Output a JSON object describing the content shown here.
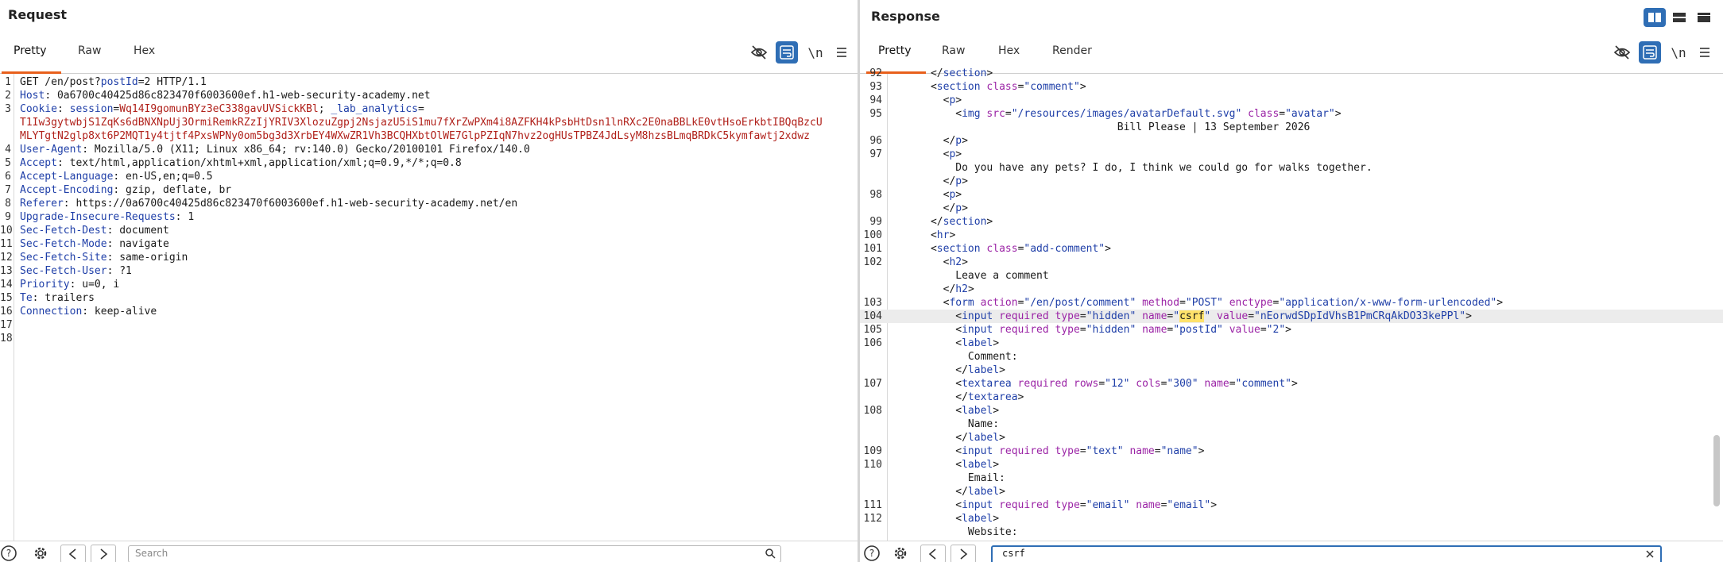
{
  "request": {
    "title": "Request",
    "tabs": [
      "Pretty",
      "Raw",
      "Hex"
    ],
    "active_tab": "Pretty",
    "newline_label": "\\n",
    "search_placeholder": "Search",
    "lines": [
      {
        "n": "1",
        "parts": [
          [
            "",
            "GET /en/post?"
          ],
          [
            "k",
            "postId"
          ],
          [
            "",
            "=2 HTTP/1.1"
          ]
        ]
      },
      {
        "n": "2",
        "parts": [
          [
            "k",
            "Host"
          ],
          [
            "",
            ": 0a6700c40425d86c823470f6003600ef.h1-web-security-academy.net"
          ]
        ]
      },
      {
        "n": "3",
        "parts": [
          [
            "k",
            "Cookie"
          ],
          [
            "",
            ": "
          ],
          [
            "k",
            "session"
          ],
          [
            "",
            "="
          ],
          [
            "v",
            "Wq14I9gomunBYz3eC338gavUVSickKBl"
          ],
          [
            "",
            "; "
          ],
          [
            "k",
            "_lab_analytics"
          ],
          [
            "",
            "="
          ]
        ]
      },
      {
        "n": "",
        "parts": [
          [
            "v",
            "T1Iw3gytwbjS1ZqKs6dBNXNpUj3OrmiRemkRZzIjYRIV3XlozuZgpj2NsjazU5iS1mu7fXrZwPXm4i8AZFKH4kPsbHtDsn1lnRXc2E0naBBLkE0vtHsoErkbtIBQqBzcU"
          ]
        ]
      },
      {
        "n": "",
        "parts": [
          [
            "v",
            "MLYTgtN2glp8xt6P2MQT1y4tjtf4PxsWPNy0om5bg3d3XrbEY4WXwZR1Vh3BCQHXbtOlWE7GlpPZIqN7hvz2ogHUsTPBZ4JdLsyM8hzsBLmqBRDkC5kymfawtj2xdwz"
          ]
        ]
      },
      {
        "n": "4",
        "parts": [
          [
            "k",
            "User-Agent"
          ],
          [
            "",
            ": Mozilla/5.0 (X11; Linux x86_64; rv:140.0) Gecko/20100101 Firefox/140.0"
          ]
        ]
      },
      {
        "n": "5",
        "parts": [
          [
            "k",
            "Accept"
          ],
          [
            "",
            ": text/html,application/xhtml+xml,application/xml;q=0.9,*/*;q=0.8"
          ]
        ]
      },
      {
        "n": "6",
        "parts": [
          [
            "k",
            "Accept-Language"
          ],
          [
            "",
            ": en-US,en;q=0.5"
          ]
        ]
      },
      {
        "n": "7",
        "parts": [
          [
            "k",
            "Accept-Encoding"
          ],
          [
            "",
            ": gzip, deflate, br"
          ]
        ]
      },
      {
        "n": "8",
        "parts": [
          [
            "k",
            "Referer"
          ],
          [
            "",
            ": https://0a6700c40425d86c823470f6003600ef.h1-web-security-academy.net/en"
          ]
        ]
      },
      {
        "n": "9",
        "parts": [
          [
            "k",
            "Upgrade-Insecure-Requests"
          ],
          [
            "",
            ": 1"
          ]
        ]
      },
      {
        "n": "10",
        "parts": [
          [
            "k",
            "Sec-Fetch-Dest"
          ],
          [
            "",
            ": document"
          ]
        ]
      },
      {
        "n": "11",
        "parts": [
          [
            "k",
            "Sec-Fetch-Mode"
          ],
          [
            "",
            ": navigate"
          ]
        ]
      },
      {
        "n": "12",
        "parts": [
          [
            "k",
            "Sec-Fetch-Site"
          ],
          [
            "",
            ": same-origin"
          ]
        ]
      },
      {
        "n": "13",
        "parts": [
          [
            "k",
            "Sec-Fetch-User"
          ],
          [
            "",
            ": ?1"
          ]
        ]
      },
      {
        "n": "14",
        "parts": [
          [
            "k",
            "Priority"
          ],
          [
            "",
            ": u=0, i"
          ]
        ]
      },
      {
        "n": "15",
        "parts": [
          [
            "k",
            "Te"
          ],
          [
            "",
            ": trailers"
          ]
        ]
      },
      {
        "n": "16",
        "parts": [
          [
            "k",
            "Connection"
          ],
          [
            "",
            ": keep-alive"
          ]
        ]
      },
      {
        "n": "17",
        "parts": []
      },
      {
        "n": "18",
        "parts": []
      }
    ]
  },
  "response": {
    "title": "Response",
    "tabs": [
      "Pretty",
      "Raw",
      "Hex",
      "Render"
    ],
    "active_tab": "Pretty",
    "newline_label": "\\n",
    "search_value": "csrf",
    "lines": [
      {
        "n": "92",
        "parts": [
          [
            "",
            "      </"
          ],
          [
            "t",
            "section"
          ],
          [
            "",
            ">"
          ]
        ]
      },
      {
        "n": "93",
        "parts": [
          [
            "",
            "      <"
          ],
          [
            "t",
            "section"
          ],
          [
            "",
            " "
          ],
          [
            "a",
            "class"
          ],
          [
            "",
            "="
          ],
          [
            "s",
            "\"comment\""
          ],
          [
            "",
            ">"
          ]
        ]
      },
      {
        "n": "94",
        "parts": [
          [
            "",
            "        <"
          ],
          [
            "t",
            "p"
          ],
          [
            "",
            ">"
          ]
        ]
      },
      {
        "n": "95",
        "parts": [
          [
            "",
            "          <"
          ],
          [
            "t",
            "img"
          ],
          [
            "",
            " "
          ],
          [
            "a",
            "src"
          ],
          [
            "",
            "="
          ],
          [
            "s",
            "\"/resources/images/avatarDefault.svg\""
          ],
          [
            "",
            " "
          ],
          [
            "a",
            "class"
          ],
          [
            "",
            "="
          ],
          [
            "s",
            "\"avatar\""
          ],
          [
            "",
            ">"
          ]
        ]
      },
      {
        "n": "",
        "parts": [
          [
            "",
            "                                    Bill Please | 13 September 2026"
          ]
        ]
      },
      {
        "n": "96",
        "parts": [
          [
            "",
            "        </"
          ],
          [
            "t",
            "p"
          ],
          [
            "",
            ">"
          ]
        ]
      },
      {
        "n": "97",
        "parts": [
          [
            "",
            "        <"
          ],
          [
            "t",
            "p"
          ],
          [
            "",
            ">"
          ]
        ]
      },
      {
        "n": "",
        "parts": [
          [
            "",
            "          Do you have any pets? I do, I think we could go for walks together."
          ]
        ]
      },
      {
        "n": "",
        "parts": [
          [
            "",
            "        </"
          ],
          [
            "t",
            "p"
          ],
          [
            "",
            ">"
          ]
        ]
      },
      {
        "n": "98",
        "parts": [
          [
            "",
            "        <"
          ],
          [
            "t",
            "p"
          ],
          [
            "",
            ">"
          ]
        ]
      },
      {
        "n": "",
        "parts": [
          [
            "",
            "        </"
          ],
          [
            "t",
            "p"
          ],
          [
            "",
            ">"
          ]
        ]
      },
      {
        "n": "99",
        "parts": [
          [
            "",
            "      </"
          ],
          [
            "t",
            "section"
          ],
          [
            "",
            ">"
          ]
        ]
      },
      {
        "n": "100",
        "parts": [
          [
            "",
            "      <"
          ],
          [
            "t",
            "hr"
          ],
          [
            "",
            ">"
          ]
        ]
      },
      {
        "n": "101",
        "parts": [
          [
            "",
            "      <"
          ],
          [
            "t",
            "section"
          ],
          [
            "",
            " "
          ],
          [
            "a",
            "class"
          ],
          [
            "",
            "="
          ],
          [
            "s",
            "\"add-comment\""
          ],
          [
            "",
            ">"
          ]
        ]
      },
      {
        "n": "102",
        "parts": [
          [
            "",
            "        <"
          ],
          [
            "t",
            "h2"
          ],
          [
            "",
            ">"
          ]
        ]
      },
      {
        "n": "",
        "parts": [
          [
            "",
            "          Leave a comment"
          ]
        ]
      },
      {
        "n": "",
        "parts": [
          [
            "",
            "        </"
          ],
          [
            "t",
            "h2"
          ],
          [
            "",
            ">"
          ]
        ]
      },
      {
        "n": "103",
        "parts": [
          [
            "",
            "        <"
          ],
          [
            "t",
            "form"
          ],
          [
            "",
            " "
          ],
          [
            "a",
            "action"
          ],
          [
            "",
            "="
          ],
          [
            "s",
            "\"/en/post/comment\""
          ],
          [
            "",
            " "
          ],
          [
            "a",
            "method"
          ],
          [
            "",
            "="
          ],
          [
            "s",
            "\"POST\""
          ],
          [
            "",
            " "
          ],
          [
            "a",
            "enctype"
          ],
          [
            "",
            "="
          ],
          [
            "s",
            "\"application/x-www-form-urlencoded\""
          ],
          [
            "",
            ">"
          ]
        ]
      },
      {
        "n": "104",
        "hl": true,
        "parts": [
          [
            "",
            "          <"
          ],
          [
            "t",
            "input"
          ],
          [
            "",
            " "
          ],
          [
            "a",
            "required"
          ],
          [
            "",
            " "
          ],
          [
            "a",
            "type"
          ],
          [
            "",
            "="
          ],
          [
            "s",
            "\"hidden\""
          ],
          [
            "",
            " "
          ],
          [
            "a",
            "name"
          ],
          [
            "",
            "="
          ],
          [
            "s",
            "\""
          ],
          [
            "mark",
            "csrf"
          ],
          [
            "s",
            "\""
          ],
          [
            "",
            " "
          ],
          [
            "a",
            "value"
          ],
          [
            "",
            "="
          ],
          [
            "s",
            "\"nEorwdSDpIdVhsB1PmCRqAkDO33kePPl\""
          ],
          [
            "",
            ">"
          ]
        ]
      },
      {
        "n": "105",
        "parts": [
          [
            "",
            "          <"
          ],
          [
            "t",
            "input"
          ],
          [
            "",
            " "
          ],
          [
            "a",
            "required"
          ],
          [
            "",
            " "
          ],
          [
            "a",
            "type"
          ],
          [
            "",
            "="
          ],
          [
            "s",
            "\"hidden\""
          ],
          [
            "",
            " "
          ],
          [
            "a",
            "name"
          ],
          [
            "",
            "="
          ],
          [
            "s",
            "\"postId\""
          ],
          [
            "",
            " "
          ],
          [
            "a",
            "value"
          ],
          [
            "",
            "="
          ],
          [
            "s",
            "\"2\""
          ],
          [
            "",
            ">"
          ]
        ]
      },
      {
        "n": "106",
        "parts": [
          [
            "",
            "          <"
          ],
          [
            "t",
            "label"
          ],
          [
            "",
            ">"
          ]
        ]
      },
      {
        "n": "",
        "parts": [
          [
            "",
            "            Comment:"
          ]
        ]
      },
      {
        "n": "",
        "parts": [
          [
            "",
            "          </"
          ],
          [
            "t",
            "label"
          ],
          [
            "",
            ">"
          ]
        ]
      },
      {
        "n": "107",
        "parts": [
          [
            "",
            "          <"
          ],
          [
            "t",
            "textarea"
          ],
          [
            "",
            " "
          ],
          [
            "a",
            "required"
          ],
          [
            "",
            " "
          ],
          [
            "a",
            "rows"
          ],
          [
            "",
            "="
          ],
          [
            "s",
            "\"12\""
          ],
          [
            "",
            " "
          ],
          [
            "a",
            "cols"
          ],
          [
            "",
            "="
          ],
          [
            "s",
            "\"300\""
          ],
          [
            "",
            " "
          ],
          [
            "a",
            "name"
          ],
          [
            "",
            "="
          ],
          [
            "s",
            "\"comment\""
          ],
          [
            "",
            ">"
          ]
        ]
      },
      {
        "n": "",
        "parts": [
          [
            "",
            "          </"
          ],
          [
            "t",
            "textarea"
          ],
          [
            "",
            ">"
          ]
        ]
      },
      {
        "n": "108",
        "parts": [
          [
            "",
            "          <"
          ],
          [
            "t",
            "label"
          ],
          [
            "",
            ">"
          ]
        ]
      },
      {
        "n": "",
        "parts": [
          [
            "",
            "            Name:"
          ]
        ]
      },
      {
        "n": "",
        "parts": [
          [
            "",
            "          </"
          ],
          [
            "t",
            "label"
          ],
          [
            "",
            ">"
          ]
        ]
      },
      {
        "n": "109",
        "parts": [
          [
            "",
            "          <"
          ],
          [
            "t",
            "input"
          ],
          [
            "",
            " "
          ],
          [
            "a",
            "required"
          ],
          [
            "",
            " "
          ],
          [
            "a",
            "type"
          ],
          [
            "",
            "="
          ],
          [
            "s",
            "\"text\""
          ],
          [
            "",
            " "
          ],
          [
            "a",
            "name"
          ],
          [
            "",
            "="
          ],
          [
            "s",
            "\"name\""
          ],
          [
            "",
            ">"
          ]
        ]
      },
      {
        "n": "110",
        "parts": [
          [
            "",
            "          <"
          ],
          [
            "t",
            "label"
          ],
          [
            "",
            ">"
          ]
        ]
      },
      {
        "n": "",
        "parts": [
          [
            "",
            "            Email:"
          ]
        ]
      },
      {
        "n": "",
        "parts": [
          [
            "",
            "          </"
          ],
          [
            "t",
            "label"
          ],
          [
            "",
            ">"
          ]
        ]
      },
      {
        "n": "111",
        "parts": [
          [
            "",
            "          <"
          ],
          [
            "t",
            "input"
          ],
          [
            "",
            " "
          ],
          [
            "a",
            "required"
          ],
          [
            "",
            " "
          ],
          [
            "a",
            "type"
          ],
          [
            "",
            "="
          ],
          [
            "s",
            "\"email\""
          ],
          [
            "",
            " "
          ],
          [
            "a",
            "name"
          ],
          [
            "",
            "="
          ],
          [
            "s",
            "\"email\""
          ],
          [
            "",
            ">"
          ]
        ]
      },
      {
        "n": "112",
        "parts": [
          [
            "",
            "          <"
          ],
          [
            "t",
            "label"
          ],
          [
            "",
            ">"
          ]
        ]
      },
      {
        "n": "",
        "parts": [
          [
            "",
            "            Website:"
          ]
        ]
      },
      {
        "n": "",
        "parts": [
          [
            "",
            "          </"
          ],
          [
            "t",
            "label"
          ],
          [
            "",
            ">"
          ]
        ]
      }
    ]
  },
  "colors": {
    "accent": "#e8601c",
    "toggle_on": "#2f6eb5",
    "key": "#1f3fa8",
    "value": "#b0201a",
    "attr": "#9b24a6"
  },
  "icons": [
    "eye-off-icon",
    "wrap-icon",
    "menu-icon",
    "help-icon",
    "gear-icon",
    "prev-arrow-icon",
    "next-arrow-icon",
    "search-icon",
    "layout-icons"
  ]
}
